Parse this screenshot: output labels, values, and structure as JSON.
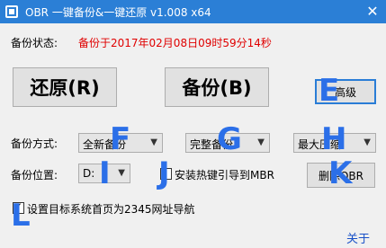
{
  "window": {
    "title": "OBR 一键备份&一键还原 v1.008 x64",
    "close_glyph": "✕"
  },
  "status": {
    "label": "备份状态:",
    "value": "备份于2017年02月08日09时59分14秒"
  },
  "buttons": {
    "restore": "还原(R)",
    "backup": "备份(B)",
    "advanced": "高级",
    "delete_obr": "删除OBR"
  },
  "backup_mode": {
    "label": "备份方式:",
    "selected": "全新备份"
  },
  "backup_type": {
    "selected": "完整备份"
  },
  "compression": {
    "selected": "最大压缩"
  },
  "backup_location": {
    "label": "备份位置:",
    "selected": "D:"
  },
  "hotkey_checkbox": {
    "label": "安装热键引导到MBR",
    "checked": false
  },
  "homepage_checkbox": {
    "label": "设置目标系统首页为2345网址导航",
    "checked": true
  },
  "about_link": "关于",
  "overlay_letters": {
    "E": "E",
    "F": "F",
    "G": "G",
    "H": "H",
    "I": "I",
    "J": "J",
    "K": "K",
    "L": "L"
  },
  "colors": {
    "titlebar": "#2b7fd6",
    "status_value": "#e00000",
    "overlay": "#2b6fe8",
    "link": "#1a52c8"
  }
}
